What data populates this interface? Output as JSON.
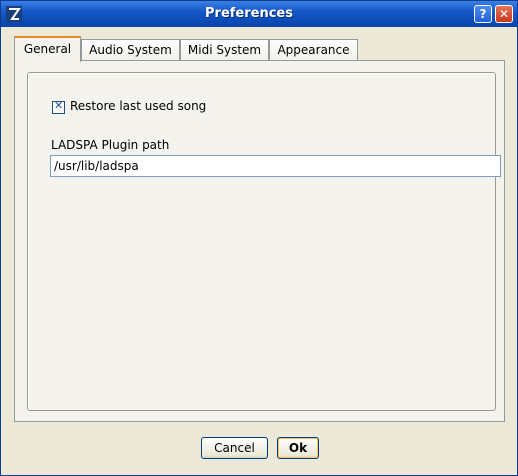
{
  "window": {
    "title": "Preferences",
    "help_label": "?",
    "close_label": "✕",
    "app_icon": "hydrogen-logo-icon"
  },
  "tabs": [
    {
      "label": "General",
      "active": true
    },
    {
      "label": "Audio System",
      "active": false
    },
    {
      "label": "Midi System",
      "active": false
    },
    {
      "label": "Appearance",
      "active": false
    }
  ],
  "general": {
    "restore_song": {
      "label": "Restore last used song",
      "checked": true
    },
    "ladspa": {
      "label": "LADSPA Plugin path",
      "value": "/usr/lib/ladspa"
    }
  },
  "buttons": {
    "cancel": "Cancel",
    "ok": "Ok"
  },
  "colors": {
    "title_bar": "#0d4cb8",
    "active_tab_accent": "#e68b2c",
    "window_bg": "#ece9d8"
  }
}
